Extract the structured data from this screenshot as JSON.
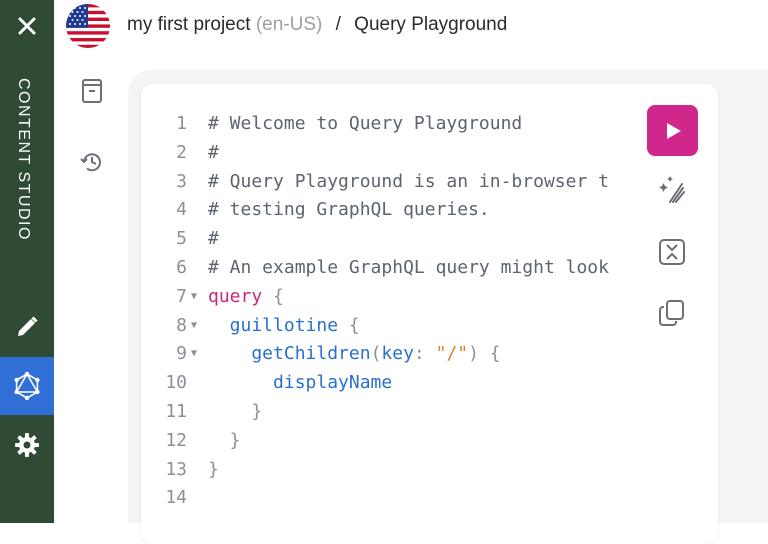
{
  "app": {
    "vertical_title": "CONTENT STUDIO",
    "sidebar": {
      "close_icon": "close-icon",
      "items": [
        {
          "name": "edit",
          "icon": "pencil-icon",
          "active": false
        },
        {
          "name": "graphql",
          "icon": "graphql-icon",
          "active": true
        },
        {
          "name": "settings",
          "icon": "gear-icon",
          "active": false
        }
      ],
      "colors": {
        "bg": "#2f4a35",
        "active": "#2f6fd6"
      }
    }
  },
  "header": {
    "project": "my first project",
    "locale": "(en-US)",
    "separator": "/",
    "page": "Query Playground",
    "flag_icon": "us-flag-icon"
  },
  "side_tools": [
    {
      "icon": "document-icon"
    },
    {
      "icon": "history-icon"
    }
  ],
  "editor": {
    "lines": [
      {
        "n": "1",
        "fold": "",
        "parts": [
          {
            "t": "# Welcome to Query Playground",
            "c": "c-comment"
          }
        ]
      },
      {
        "n": "2",
        "fold": "",
        "parts": [
          {
            "t": "#",
            "c": "c-comment"
          }
        ]
      },
      {
        "n": "3",
        "fold": "",
        "parts": [
          {
            "t": "# Query Playground is an in-browser t",
            "c": "c-comment"
          }
        ]
      },
      {
        "n": "4",
        "fold": "",
        "parts": [
          {
            "t": "# testing GraphQL queries.",
            "c": "c-comment"
          }
        ]
      },
      {
        "n": "5",
        "fold": "",
        "parts": [
          {
            "t": "#",
            "c": "c-comment"
          }
        ]
      },
      {
        "n": "6",
        "fold": "",
        "parts": [
          {
            "t": "# An example GraphQL query might look",
            "c": "c-comment"
          }
        ]
      },
      {
        "n": "7",
        "fold": "▼",
        "parts": [
          {
            "t": "query",
            "c": "c-keyword"
          },
          {
            "t": " {",
            "c": "c-punct"
          }
        ]
      },
      {
        "n": "8",
        "fold": "▼",
        "parts": [
          {
            "t": "  guillotine",
            "c": "c-field"
          },
          {
            "t": " {",
            "c": "c-punct"
          }
        ]
      },
      {
        "n": "9",
        "fold": "▼",
        "parts": [
          {
            "t": "    getChildren",
            "c": "c-field"
          },
          {
            "t": "(",
            "c": "c-punct"
          },
          {
            "t": "key",
            "c": "c-arg"
          },
          {
            "t": ": ",
            "c": "c-punct"
          },
          {
            "t": "\"/\"",
            "c": "c-string"
          },
          {
            "t": ") {",
            "c": "c-punct"
          }
        ]
      },
      {
        "n": "10",
        "fold": "",
        "parts": [
          {
            "t": "      displayName",
            "c": "c-field"
          }
        ]
      },
      {
        "n": "11",
        "fold": "",
        "parts": [
          {
            "t": "    }",
            "c": "c-punct"
          }
        ]
      },
      {
        "n": "12",
        "fold": "",
        "parts": [
          {
            "t": "  }",
            "c": "c-punct"
          }
        ]
      },
      {
        "n": "13",
        "fold": "",
        "parts": [
          {
            "t": "}",
            "c": "c-punct"
          }
        ]
      },
      {
        "n": "14",
        "fold": "",
        "parts": []
      }
    ]
  },
  "toolbar": {
    "run_icon": "play-icon",
    "prettify_icon": "prettify-icon",
    "merge_icon": "merge-fragments-icon",
    "copy_icon": "copy-icon",
    "run_color": "#d0278c"
  }
}
